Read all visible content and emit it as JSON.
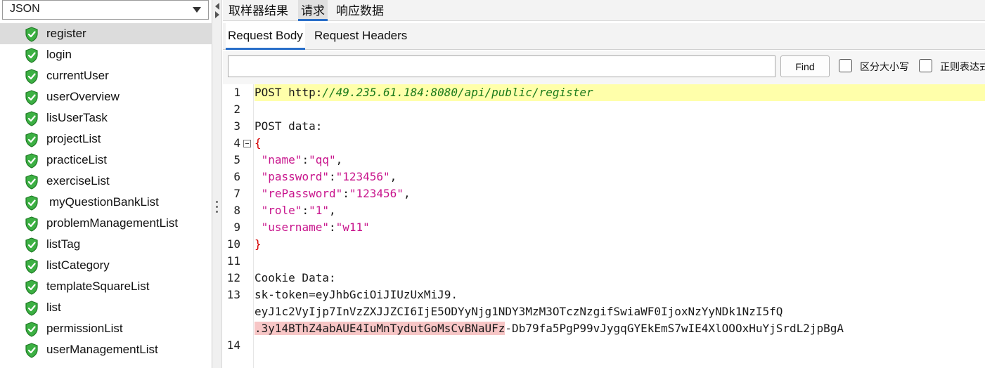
{
  "left_panel": {
    "renderer_value": "JSON",
    "tree_items": [
      {
        "label": "register",
        "selected": true
      },
      {
        "label": "login"
      },
      {
        "label": "currentUser"
      },
      {
        "label": "userOverview"
      },
      {
        "label": "lisUserTask"
      },
      {
        "label": "projectList"
      },
      {
        "label": "practiceList"
      },
      {
        "label": "exerciseList"
      },
      {
        "label": "myQuestionBankList"
      },
      {
        "label": "problemManagementList"
      },
      {
        "label": "listTag"
      },
      {
        "label": "listCategory"
      },
      {
        "label": "templateSquareList"
      },
      {
        "label": "list"
      },
      {
        "label": "permissionList"
      },
      {
        "label": "userManagementList"
      }
    ],
    "status_icon": "green-shield-check-icon"
  },
  "top_tabs": [
    "取样器结果",
    "请求",
    "响应数据"
  ],
  "sub_tabs": [
    "Request Body",
    "Request Headers"
  ],
  "find": {
    "value": "",
    "button": "Find",
    "case_sensitive_label": "区分大小写",
    "regex_label": "正则表达式"
  },
  "editor": {
    "line_numbers": [
      "1",
      "2",
      "3",
      "4",
      "5",
      "6",
      "7",
      "8",
      "9",
      "10",
      "11",
      "12",
      "13",
      "14"
    ],
    "line1_method": "POST ",
    "line1_scheme": "http:",
    "line1_url": "//49.235.61.184:8080/api/public/register",
    "line3": "POST data:",
    "line4": "{",
    "fields": [
      {
        "key": "\"name\"",
        "sep": ":",
        "value": "\"qq\"",
        "end": ","
      },
      {
        "key": "\"password\"",
        "sep": ":",
        "value": "\"123456\"",
        "end": ","
      },
      {
        "key": "\"rePassword\"",
        "sep": ":",
        "value": "\"123456\"",
        "end": ","
      },
      {
        "key": "\"role\"",
        "sep": ":",
        "value": "\"1\"",
        "end": ","
      },
      {
        "key": "\"username\"",
        "sep": ":",
        "value": "\"w11\"",
        "end": ""
      }
    ],
    "line10": "}",
    "line12": "Cookie Data:",
    "line13a": "sk-token=eyJhbGciOiJIUzUxMiJ9.",
    "line13b": "eyJ1c2VyIjp7InVzZXJJZCI6IjE5ODYyNjg1NDY3MzM3OTczNzgifSwiaWF0IjoxNzYyNDk1NzI5fQ",
    "line13c_sel": ".3y14BThZ4abAUE4IuMnTydutGoMsCvBNaUFz",
    "line13c_rest": "-Db79fa5PgP99vJygqGYEkEmS7wIE4XlOOOxHuYjSrdL2jpBgA"
  },
  "colors": {
    "accent_tab": "#2a6fc9",
    "highlight_line": "#ffffaa",
    "selection": "#f7c6c6",
    "json_key": "#c8148c",
    "brace": "#d40000",
    "url": "#1a7a1a"
  }
}
